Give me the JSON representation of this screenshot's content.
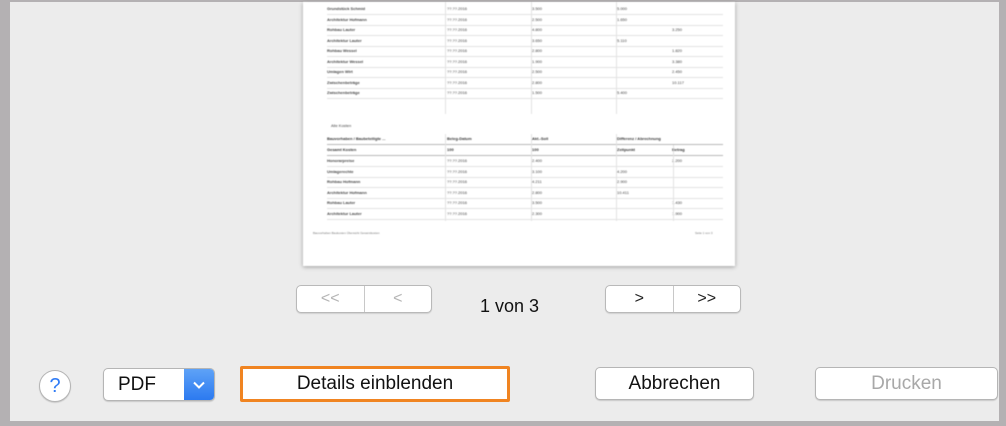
{
  "preview": {
    "rows_top": [
      {
        "name": "Grundstück Schmid",
        "c2": "??.??.2016",
        "c3": "3.500",
        "c4": "5.000",
        "c5": ""
      },
      {
        "name": "Architektur Hofmann",
        "c2": "??.??.2016",
        "c3": "2.500",
        "c4": "1.650",
        "c5": ""
      },
      {
        "name": "Rohbau Lauter",
        "c2": "??.??.2016",
        "c3": "4.800",
        "c4": "",
        "c5": "3.250"
      },
      {
        "name": "Architektur Lauter",
        "c2": "??.??.2016",
        "c3": "3.650",
        "c4": "5.110",
        "c5": ""
      },
      {
        "name": "Rohbau Wessel",
        "c2": "??.??.2016",
        "c3": "2.800",
        "c4": "",
        "c5": "1.820"
      },
      {
        "name": "Architektur Wessel",
        "c2": "??.??.2016",
        "c3": "1.900",
        "c4": "",
        "c5": "3.380"
      },
      {
        "name": "Umlagen Wirt",
        "c2": "??.??.2016",
        "c3": "2.500",
        "c4": "",
        "c5": "2.450"
      },
      {
        "name": "Zwischenbeträge",
        "c2": "??.??.2016",
        "c3": "2.800",
        "c4": "",
        "c5": "10.117"
      },
      {
        "name": "Zwischenbeträge",
        "c2": "??.??.2016",
        "c3": "1.500",
        "c4": "5.400",
        "c5": ""
      }
    ],
    "section_title": "Alle Kosten",
    "header": {
      "c1": "Bauvorhaben / Baubeteiligte ...",
      "c2": "Beleg-Datum",
      "c3": "Akt.-Soll",
      "c4": "Differenz / Abrechnung",
      "c5": ""
    },
    "subheader": {
      "c1": "Gesamt Kosten",
      "c2": "100",
      "c3": "100",
      "c4": "Zeitpunkt",
      "c5": "Betrag"
    },
    "rows_bottom": [
      {
        "name": "Honorarpreise",
        "c2": "??.??.2016",
        "c3": "2.400",
        "c4": "",
        "c5": "2.200"
      },
      {
        "name": "Umlagerechte",
        "c2": "??.??.2016",
        "c3": "3.100",
        "c4": "4.200",
        "c5": ""
      },
      {
        "name": "Rohbau Hofmann",
        "c2": "??.??.2016",
        "c3": "4.211",
        "c4": "2.900",
        "c5": ""
      },
      {
        "name": "Architektur Hofmann",
        "c2": "??.??.2016",
        "c3": "2.800",
        "c4": "10.411",
        "c5": ""
      },
      {
        "name": "Rohbau Lauter",
        "c2": "??.??.2016",
        "c3": "3.500",
        "c4": "",
        "c5": "1.430"
      },
      {
        "name": "Architektur Lauter",
        "c2": "??.??.2016",
        "c3": "2.300",
        "c4": "",
        "c5": "1.900"
      }
    ],
    "footer_left": "Bauvorhaben Baukosten Übersicht Gesamtkosten",
    "footer_right": "Seite 1 von 3"
  },
  "pager": {
    "first_label": "<<",
    "prev_label": "<",
    "next_label": ">",
    "last_label": ">>",
    "page_indicator": "1 von 3"
  },
  "buttons": {
    "help_label": "?",
    "pdf_label": "PDF",
    "details_label": "Details einblenden",
    "cancel_label": "Abbrechen",
    "print_label": "Drucken"
  },
  "colors": {
    "accent": "#2f7bf5",
    "highlight": "#f08421",
    "window_frame": "#b4b1b3",
    "dialog_background": "#ececec"
  },
  "icons": {
    "help": "question-mark",
    "pdf_menu": "chevron-down"
  }
}
